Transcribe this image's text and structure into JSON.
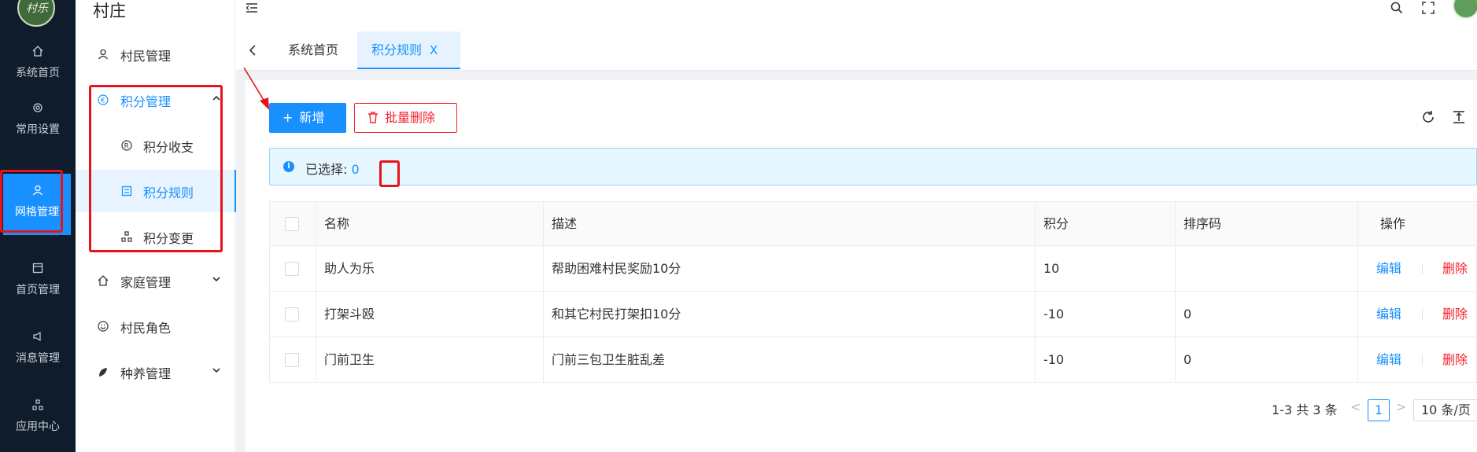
{
  "app": {
    "title": "村庄",
    "logo_text": "村乐"
  },
  "rail": [
    {
      "id": "home",
      "label": "系统首页",
      "icon": "home-icon"
    },
    {
      "id": "settings",
      "label": "常用设置",
      "icon": "gear-icon"
    },
    {
      "id": "grid",
      "label": "网格管理",
      "icon": "user-icon",
      "active": true
    },
    {
      "id": "homepage",
      "label": "首页管理",
      "icon": "layout-icon"
    },
    {
      "id": "message",
      "label": "消息管理",
      "icon": "speaker-icon"
    },
    {
      "id": "apps",
      "label": "应用中心",
      "icon": "apps-icon"
    }
  ],
  "sidebar": {
    "villager": "村民管理",
    "points": "积分管理",
    "points_income": "积分收支",
    "points_rules": "积分规则",
    "points_change": "积分变更",
    "family": "家庭管理",
    "role": "村民角色",
    "farming": "种养管理"
  },
  "tabs": {
    "home": "系统首页",
    "rules": "积分规则",
    "close": "X"
  },
  "toolbar": {
    "add": "新增",
    "add_icon": "+",
    "batch_delete": "批量删除"
  },
  "alert": {
    "label": "已选择: ",
    "count": "0"
  },
  "table": {
    "headers": {
      "name": "名称",
      "desc": "描述",
      "points": "积分",
      "sort": "排序码",
      "actions": "操作"
    },
    "rows": [
      {
        "name": "助人为乐",
        "desc": "帮助困难村民奖励10分",
        "points": "10",
        "sort": ""
      },
      {
        "name": "打架斗殴",
        "desc": "和其它村民打架扣10分",
        "points": "-10",
        "sort": "0"
      },
      {
        "name": "门前卫生",
        "desc": "门前三包卫生脏乱差",
        "points": "-10",
        "sort": "0"
      }
    ],
    "edit": "编辑",
    "delete": "删除"
  },
  "pagination": {
    "summary": "1-3 共 3 条",
    "prev": "<",
    "page": "1",
    "next": ">",
    "size": "10 条/页"
  },
  "colors": {
    "primary": "#1890ff",
    "danger": "#f5222d",
    "rail_bg": "#0f1c2b",
    "annotation": "#e8121b"
  }
}
